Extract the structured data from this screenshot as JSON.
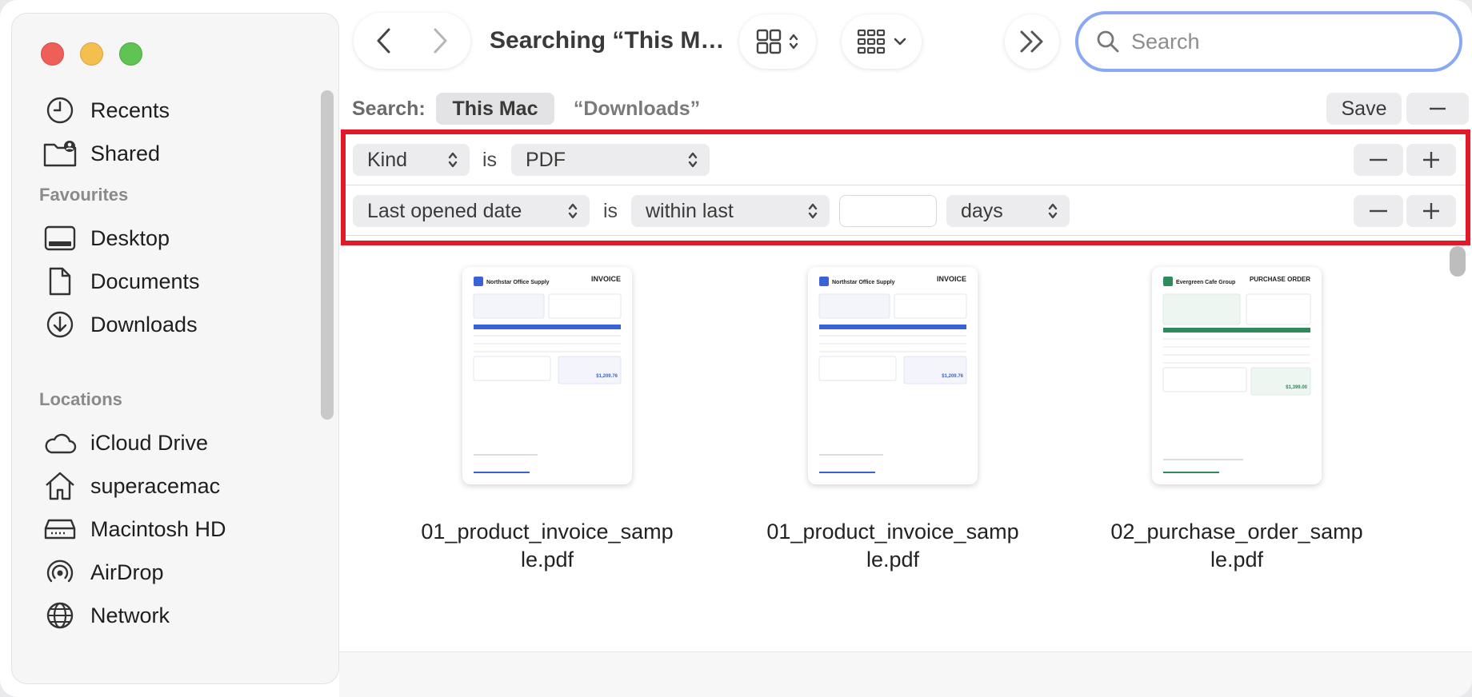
{
  "toolbar": {
    "title": "Searching “This M…",
    "search_placeholder": "Search"
  },
  "sidebar": {
    "top_items": [
      {
        "label": "Recents",
        "icon": "clock-icon"
      },
      {
        "label": "Shared",
        "icon": "shared-folder-icon"
      }
    ],
    "favourites_heading": "Favourites",
    "favourites": [
      {
        "label": "Desktop",
        "icon": "desktop-icon"
      },
      {
        "label": "Documents",
        "icon": "document-icon"
      },
      {
        "label": "Downloads",
        "icon": "download-icon"
      }
    ],
    "locations_heading": "Locations",
    "locations": [
      {
        "label": "iCloud Drive",
        "icon": "cloud-icon"
      },
      {
        "label": "superacemac",
        "icon": "home-icon"
      },
      {
        "label": "Macintosh HD",
        "icon": "hard-drive-icon"
      },
      {
        "label": "AirDrop",
        "icon": "airdrop-icon"
      },
      {
        "label": "Network",
        "icon": "globe-icon"
      }
    ]
  },
  "scope": {
    "label": "Search:",
    "this_mac": "This Mac",
    "downloads": "“Downloads”",
    "save": "Save"
  },
  "criteria": [
    {
      "attribute": "Kind",
      "operator": "is",
      "value": "PDF"
    },
    {
      "attribute": "Last opened date",
      "operator": "is",
      "value": "within last",
      "number": "",
      "unit": "days"
    }
  ],
  "files": [
    {
      "name_line1": "01_product_invoice_samp",
      "name_line2": "le.pdf",
      "doc_company": "Northstar Office Supply",
      "doc_type": "INVOICE",
      "accent": "#3a62d8"
    },
    {
      "name_line1": "01_product_invoice_samp",
      "name_line2": "le.pdf",
      "doc_company": "Northstar Office Supply",
      "doc_type": "INVOICE",
      "accent": "#3a62d8"
    },
    {
      "name_line1": "02_purchase_order_samp",
      "name_line2": "le.pdf",
      "doc_company": "Evergreen Cafe Group",
      "doc_type": "PURCHASE ORDER",
      "accent": "#2f8a5c"
    }
  ],
  "colors": {
    "highlight_border": "#e3192a",
    "search_focus": "#8aa9f3"
  }
}
